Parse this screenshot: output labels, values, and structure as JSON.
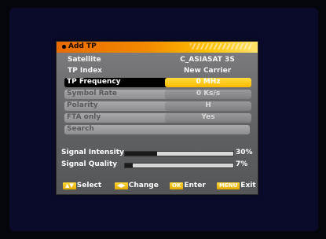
{
  "dialog": {
    "title": "Add TP"
  },
  "rows": {
    "satellite": {
      "label": "Satellite",
      "value": "C_ASIASAT 3S"
    },
    "tp_index": {
      "label": "TP Index",
      "value": "New Carrier"
    },
    "tp_frequency": {
      "label": "TP Frequency",
      "value": "0 MHz"
    },
    "symbol_rate": {
      "label": "Symbol Rate",
      "value": "0 Ks/s"
    },
    "polarity": {
      "label": "Polarity",
      "value": "H"
    },
    "fta_only": {
      "label": "FTA only",
      "value": "Yes"
    },
    "search": {
      "label": "Search"
    }
  },
  "meters": {
    "signal_intensity": {
      "label": "Signal Intensity",
      "percent": "30%",
      "level": 0.3
    },
    "signal_quality": {
      "label": "Signal Quality",
      "percent": "7%",
      "level": 0.07
    }
  },
  "footer": {
    "select": {
      "key": "▲▼",
      "label": "Select"
    },
    "change": {
      "key": "◀▶",
      "label": "Change"
    },
    "enter": {
      "key": "OK",
      "label": "Enter"
    },
    "exit": {
      "key": "MENU",
      "label": "Exit"
    }
  },
  "colors": {
    "accent": "#ffb800",
    "title_gradient_start": "#e86a00",
    "background": "#0a0b2a"
  }
}
